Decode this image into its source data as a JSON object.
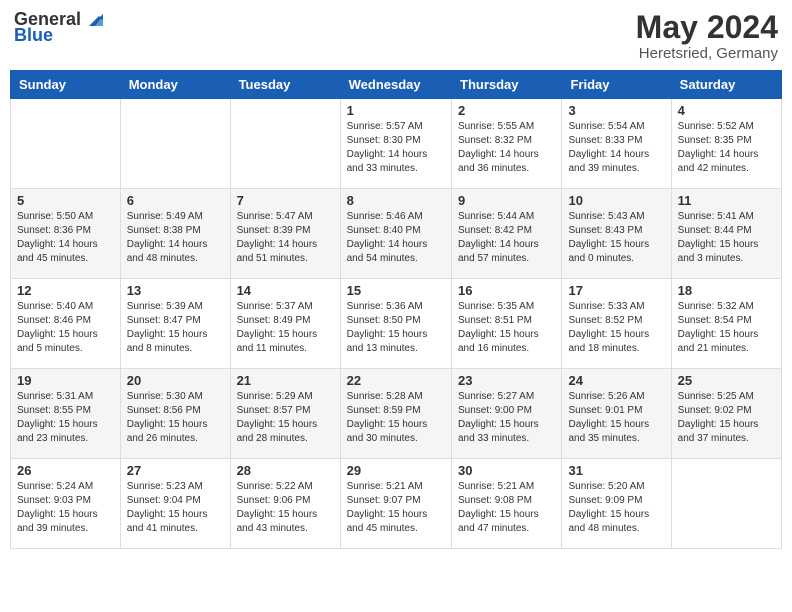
{
  "header": {
    "logo_general": "General",
    "logo_blue": "Blue",
    "month": "May 2024",
    "location": "Heretsried, Germany"
  },
  "days_of_week": [
    "Sunday",
    "Monday",
    "Tuesday",
    "Wednesday",
    "Thursday",
    "Friday",
    "Saturday"
  ],
  "weeks": [
    [
      {
        "day": "",
        "info": ""
      },
      {
        "day": "",
        "info": ""
      },
      {
        "day": "",
        "info": ""
      },
      {
        "day": "1",
        "info": "Sunrise: 5:57 AM\nSunset: 8:30 PM\nDaylight: 14 hours\nand 33 minutes."
      },
      {
        "day": "2",
        "info": "Sunrise: 5:55 AM\nSunset: 8:32 PM\nDaylight: 14 hours\nand 36 minutes."
      },
      {
        "day": "3",
        "info": "Sunrise: 5:54 AM\nSunset: 8:33 PM\nDaylight: 14 hours\nand 39 minutes."
      },
      {
        "day": "4",
        "info": "Sunrise: 5:52 AM\nSunset: 8:35 PM\nDaylight: 14 hours\nand 42 minutes."
      }
    ],
    [
      {
        "day": "5",
        "info": "Sunrise: 5:50 AM\nSunset: 8:36 PM\nDaylight: 14 hours\nand 45 minutes."
      },
      {
        "day": "6",
        "info": "Sunrise: 5:49 AM\nSunset: 8:38 PM\nDaylight: 14 hours\nand 48 minutes."
      },
      {
        "day": "7",
        "info": "Sunrise: 5:47 AM\nSunset: 8:39 PM\nDaylight: 14 hours\nand 51 minutes."
      },
      {
        "day": "8",
        "info": "Sunrise: 5:46 AM\nSunset: 8:40 PM\nDaylight: 14 hours\nand 54 minutes."
      },
      {
        "day": "9",
        "info": "Sunrise: 5:44 AM\nSunset: 8:42 PM\nDaylight: 14 hours\nand 57 minutes."
      },
      {
        "day": "10",
        "info": "Sunrise: 5:43 AM\nSunset: 8:43 PM\nDaylight: 15 hours\nand 0 minutes."
      },
      {
        "day": "11",
        "info": "Sunrise: 5:41 AM\nSunset: 8:44 PM\nDaylight: 15 hours\nand 3 minutes."
      }
    ],
    [
      {
        "day": "12",
        "info": "Sunrise: 5:40 AM\nSunset: 8:46 PM\nDaylight: 15 hours\nand 5 minutes."
      },
      {
        "day": "13",
        "info": "Sunrise: 5:39 AM\nSunset: 8:47 PM\nDaylight: 15 hours\nand 8 minutes."
      },
      {
        "day": "14",
        "info": "Sunrise: 5:37 AM\nSunset: 8:49 PM\nDaylight: 15 hours\nand 11 minutes."
      },
      {
        "day": "15",
        "info": "Sunrise: 5:36 AM\nSunset: 8:50 PM\nDaylight: 15 hours\nand 13 minutes."
      },
      {
        "day": "16",
        "info": "Sunrise: 5:35 AM\nSunset: 8:51 PM\nDaylight: 15 hours\nand 16 minutes."
      },
      {
        "day": "17",
        "info": "Sunrise: 5:33 AM\nSunset: 8:52 PM\nDaylight: 15 hours\nand 18 minutes."
      },
      {
        "day": "18",
        "info": "Sunrise: 5:32 AM\nSunset: 8:54 PM\nDaylight: 15 hours\nand 21 minutes."
      }
    ],
    [
      {
        "day": "19",
        "info": "Sunrise: 5:31 AM\nSunset: 8:55 PM\nDaylight: 15 hours\nand 23 minutes."
      },
      {
        "day": "20",
        "info": "Sunrise: 5:30 AM\nSunset: 8:56 PM\nDaylight: 15 hours\nand 26 minutes."
      },
      {
        "day": "21",
        "info": "Sunrise: 5:29 AM\nSunset: 8:57 PM\nDaylight: 15 hours\nand 28 minutes."
      },
      {
        "day": "22",
        "info": "Sunrise: 5:28 AM\nSunset: 8:59 PM\nDaylight: 15 hours\nand 30 minutes."
      },
      {
        "day": "23",
        "info": "Sunrise: 5:27 AM\nSunset: 9:00 PM\nDaylight: 15 hours\nand 33 minutes."
      },
      {
        "day": "24",
        "info": "Sunrise: 5:26 AM\nSunset: 9:01 PM\nDaylight: 15 hours\nand 35 minutes."
      },
      {
        "day": "25",
        "info": "Sunrise: 5:25 AM\nSunset: 9:02 PM\nDaylight: 15 hours\nand 37 minutes."
      }
    ],
    [
      {
        "day": "26",
        "info": "Sunrise: 5:24 AM\nSunset: 9:03 PM\nDaylight: 15 hours\nand 39 minutes."
      },
      {
        "day": "27",
        "info": "Sunrise: 5:23 AM\nSunset: 9:04 PM\nDaylight: 15 hours\nand 41 minutes."
      },
      {
        "day": "28",
        "info": "Sunrise: 5:22 AM\nSunset: 9:06 PM\nDaylight: 15 hours\nand 43 minutes."
      },
      {
        "day": "29",
        "info": "Sunrise: 5:21 AM\nSunset: 9:07 PM\nDaylight: 15 hours\nand 45 minutes."
      },
      {
        "day": "30",
        "info": "Sunrise: 5:21 AM\nSunset: 9:08 PM\nDaylight: 15 hours\nand 47 minutes."
      },
      {
        "day": "31",
        "info": "Sunrise: 5:20 AM\nSunset: 9:09 PM\nDaylight: 15 hours\nand 48 minutes."
      },
      {
        "day": "",
        "info": ""
      }
    ]
  ]
}
